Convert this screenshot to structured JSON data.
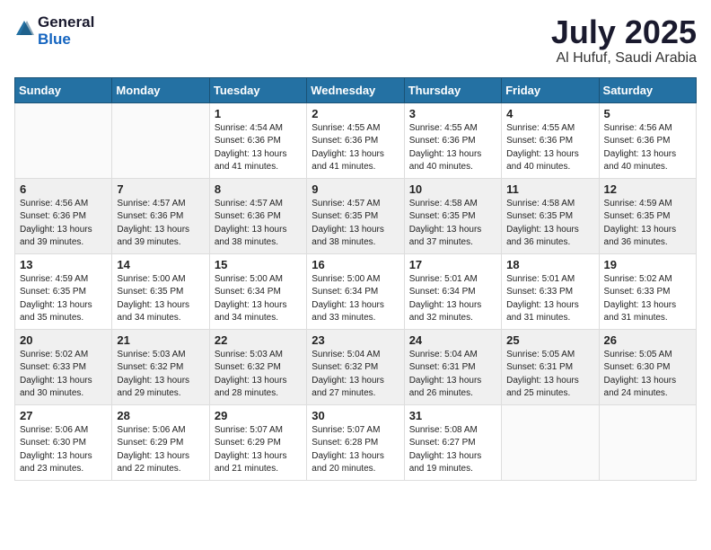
{
  "logo": {
    "general": "General",
    "blue": "Blue"
  },
  "header": {
    "month": "July 2025",
    "location": "Al Hufuf, Saudi Arabia"
  },
  "weekdays": [
    "Sunday",
    "Monday",
    "Tuesday",
    "Wednesday",
    "Thursday",
    "Friday",
    "Saturday"
  ],
  "weeks": [
    [
      {
        "day": "",
        "sunrise": "",
        "sunset": "",
        "daylight": ""
      },
      {
        "day": "",
        "sunrise": "",
        "sunset": "",
        "daylight": ""
      },
      {
        "day": "1",
        "sunrise": "Sunrise: 4:54 AM",
        "sunset": "Sunset: 6:36 PM",
        "daylight": "Daylight: 13 hours and 41 minutes."
      },
      {
        "day": "2",
        "sunrise": "Sunrise: 4:55 AM",
        "sunset": "Sunset: 6:36 PM",
        "daylight": "Daylight: 13 hours and 41 minutes."
      },
      {
        "day": "3",
        "sunrise": "Sunrise: 4:55 AM",
        "sunset": "Sunset: 6:36 PM",
        "daylight": "Daylight: 13 hours and 40 minutes."
      },
      {
        "day": "4",
        "sunrise": "Sunrise: 4:55 AM",
        "sunset": "Sunset: 6:36 PM",
        "daylight": "Daylight: 13 hours and 40 minutes."
      },
      {
        "day": "5",
        "sunrise": "Sunrise: 4:56 AM",
        "sunset": "Sunset: 6:36 PM",
        "daylight": "Daylight: 13 hours and 40 minutes."
      }
    ],
    [
      {
        "day": "6",
        "sunrise": "Sunrise: 4:56 AM",
        "sunset": "Sunset: 6:36 PM",
        "daylight": "Daylight: 13 hours and 39 minutes."
      },
      {
        "day": "7",
        "sunrise": "Sunrise: 4:57 AM",
        "sunset": "Sunset: 6:36 PM",
        "daylight": "Daylight: 13 hours and 39 minutes."
      },
      {
        "day": "8",
        "sunrise": "Sunrise: 4:57 AM",
        "sunset": "Sunset: 6:36 PM",
        "daylight": "Daylight: 13 hours and 38 minutes."
      },
      {
        "day": "9",
        "sunrise": "Sunrise: 4:57 AM",
        "sunset": "Sunset: 6:35 PM",
        "daylight": "Daylight: 13 hours and 38 minutes."
      },
      {
        "day": "10",
        "sunrise": "Sunrise: 4:58 AM",
        "sunset": "Sunset: 6:35 PM",
        "daylight": "Daylight: 13 hours and 37 minutes."
      },
      {
        "day": "11",
        "sunrise": "Sunrise: 4:58 AM",
        "sunset": "Sunset: 6:35 PM",
        "daylight": "Daylight: 13 hours and 36 minutes."
      },
      {
        "day": "12",
        "sunrise": "Sunrise: 4:59 AM",
        "sunset": "Sunset: 6:35 PM",
        "daylight": "Daylight: 13 hours and 36 minutes."
      }
    ],
    [
      {
        "day": "13",
        "sunrise": "Sunrise: 4:59 AM",
        "sunset": "Sunset: 6:35 PM",
        "daylight": "Daylight: 13 hours and 35 minutes."
      },
      {
        "day": "14",
        "sunrise": "Sunrise: 5:00 AM",
        "sunset": "Sunset: 6:35 PM",
        "daylight": "Daylight: 13 hours and 34 minutes."
      },
      {
        "day": "15",
        "sunrise": "Sunrise: 5:00 AM",
        "sunset": "Sunset: 6:34 PM",
        "daylight": "Daylight: 13 hours and 34 minutes."
      },
      {
        "day": "16",
        "sunrise": "Sunrise: 5:00 AM",
        "sunset": "Sunset: 6:34 PM",
        "daylight": "Daylight: 13 hours and 33 minutes."
      },
      {
        "day": "17",
        "sunrise": "Sunrise: 5:01 AM",
        "sunset": "Sunset: 6:34 PM",
        "daylight": "Daylight: 13 hours and 32 minutes."
      },
      {
        "day": "18",
        "sunrise": "Sunrise: 5:01 AM",
        "sunset": "Sunset: 6:33 PM",
        "daylight": "Daylight: 13 hours and 31 minutes."
      },
      {
        "day": "19",
        "sunrise": "Sunrise: 5:02 AM",
        "sunset": "Sunset: 6:33 PM",
        "daylight": "Daylight: 13 hours and 31 minutes."
      }
    ],
    [
      {
        "day": "20",
        "sunrise": "Sunrise: 5:02 AM",
        "sunset": "Sunset: 6:33 PM",
        "daylight": "Daylight: 13 hours and 30 minutes."
      },
      {
        "day": "21",
        "sunrise": "Sunrise: 5:03 AM",
        "sunset": "Sunset: 6:32 PM",
        "daylight": "Daylight: 13 hours and 29 minutes."
      },
      {
        "day": "22",
        "sunrise": "Sunrise: 5:03 AM",
        "sunset": "Sunset: 6:32 PM",
        "daylight": "Daylight: 13 hours and 28 minutes."
      },
      {
        "day": "23",
        "sunrise": "Sunrise: 5:04 AM",
        "sunset": "Sunset: 6:32 PM",
        "daylight": "Daylight: 13 hours and 27 minutes."
      },
      {
        "day": "24",
        "sunrise": "Sunrise: 5:04 AM",
        "sunset": "Sunset: 6:31 PM",
        "daylight": "Daylight: 13 hours and 26 minutes."
      },
      {
        "day": "25",
        "sunrise": "Sunrise: 5:05 AM",
        "sunset": "Sunset: 6:31 PM",
        "daylight": "Daylight: 13 hours and 25 minutes."
      },
      {
        "day": "26",
        "sunrise": "Sunrise: 5:05 AM",
        "sunset": "Sunset: 6:30 PM",
        "daylight": "Daylight: 13 hours and 24 minutes."
      }
    ],
    [
      {
        "day": "27",
        "sunrise": "Sunrise: 5:06 AM",
        "sunset": "Sunset: 6:30 PM",
        "daylight": "Daylight: 13 hours and 23 minutes."
      },
      {
        "day": "28",
        "sunrise": "Sunrise: 5:06 AM",
        "sunset": "Sunset: 6:29 PM",
        "daylight": "Daylight: 13 hours and 22 minutes."
      },
      {
        "day": "29",
        "sunrise": "Sunrise: 5:07 AM",
        "sunset": "Sunset: 6:29 PM",
        "daylight": "Daylight: 13 hours and 21 minutes."
      },
      {
        "day": "30",
        "sunrise": "Sunrise: 5:07 AM",
        "sunset": "Sunset: 6:28 PM",
        "daylight": "Daylight: 13 hours and 20 minutes."
      },
      {
        "day": "31",
        "sunrise": "Sunrise: 5:08 AM",
        "sunset": "Sunset: 6:27 PM",
        "daylight": "Daylight: 13 hours and 19 minutes."
      },
      {
        "day": "",
        "sunrise": "",
        "sunset": "",
        "daylight": ""
      },
      {
        "day": "",
        "sunrise": "",
        "sunset": "",
        "daylight": ""
      }
    ]
  ]
}
